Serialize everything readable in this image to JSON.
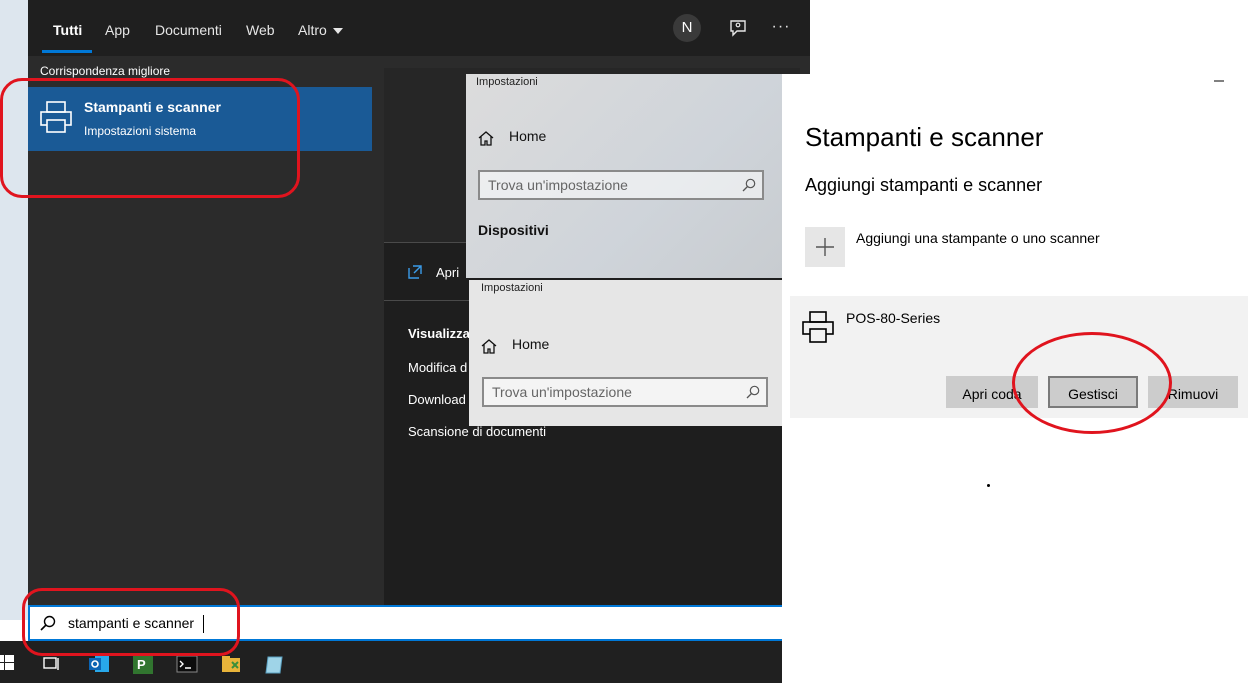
{
  "search_panel": {
    "tabs": [
      {
        "label": "Tutti",
        "active": true
      },
      {
        "label": "App"
      },
      {
        "label": "Documenti"
      },
      {
        "label": "Web"
      },
      {
        "label": "Altro"
      }
    ],
    "avatar_initial": "N",
    "more_label": "···",
    "best_match_heading": "Corrispondenza migliore",
    "best_match": {
      "title": "Stampanti e scanner",
      "subtitle": "Impostazioni sistema",
      "icon": "printer-icon"
    },
    "open_label": "Apri",
    "related_heading": "Visualizza",
    "related_items": [
      "Modifica d",
      "Download",
      "Scansione di documenti"
    ],
    "search_query": "stampanti e scanner",
    "accent_color": "#0078d7",
    "highlight_color": "#1a5a96"
  },
  "settings_overlay_1": {
    "title": "Impostazioni",
    "home_label": "Home",
    "find_placeholder": "Trova un'impostazione",
    "section_heading": "Dispositivi"
  },
  "settings_overlay_2": {
    "title": "Impostazioni",
    "home_label": "Home",
    "find_placeholder": "Trova un'impostazione"
  },
  "settings_page": {
    "minimize_label": "–",
    "title": "Stampanti e scanner",
    "add_heading": "Aggiungi stampanti e scanner",
    "add_label": "Aggiungi una stampante o uno scanner",
    "printer": {
      "name": "POS-80-Series",
      "buttons": {
        "open_queue": "Apri coda",
        "manage": "Gestisci",
        "remove": "Rimuovi"
      }
    }
  },
  "annotation_color": "#e0141e"
}
